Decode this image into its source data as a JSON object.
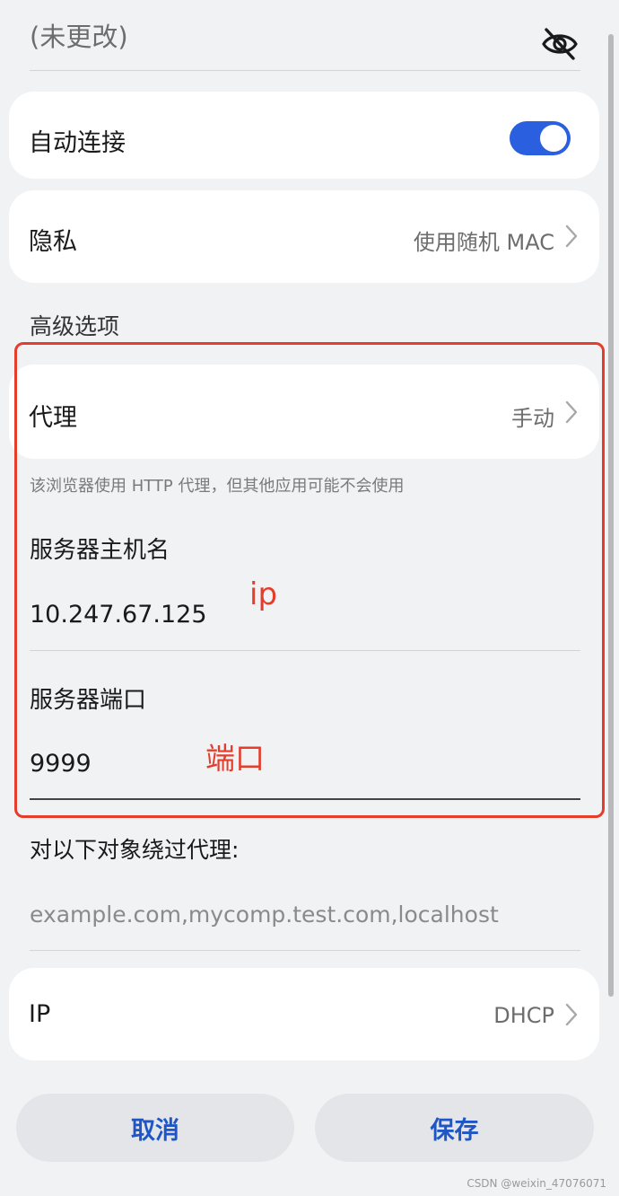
{
  "password": {
    "value": "(未更改)"
  },
  "auto_connect": {
    "label": "自动连接",
    "enabled": true,
    "accent": "#2a5fe0"
  },
  "privacy": {
    "label": "隐私",
    "value": "使用随机 MAC"
  },
  "advanced": {
    "section_label": "高级选项"
  },
  "proxy": {
    "label": "代理",
    "value": "手动",
    "hint": "该浏览器使用 HTTP 代理，但其他应用可能不会使用",
    "host_label": "服务器主机名",
    "host_value": "10.247.67.125",
    "port_label": "服务器端口",
    "port_value": "9999",
    "bypass_label": "对以下对象绕过代理:",
    "bypass_placeholder": "example.com,mycomp.test.com,localhost"
  },
  "annotations": {
    "ip": "ip",
    "port": "端口",
    "color": "#e53d2c"
  },
  "ip_settings": {
    "label": "IP",
    "value": "DHCP"
  },
  "buttons": {
    "cancel": "取消",
    "save": "保存"
  },
  "watermark": "CSDN @weixin_47076071"
}
